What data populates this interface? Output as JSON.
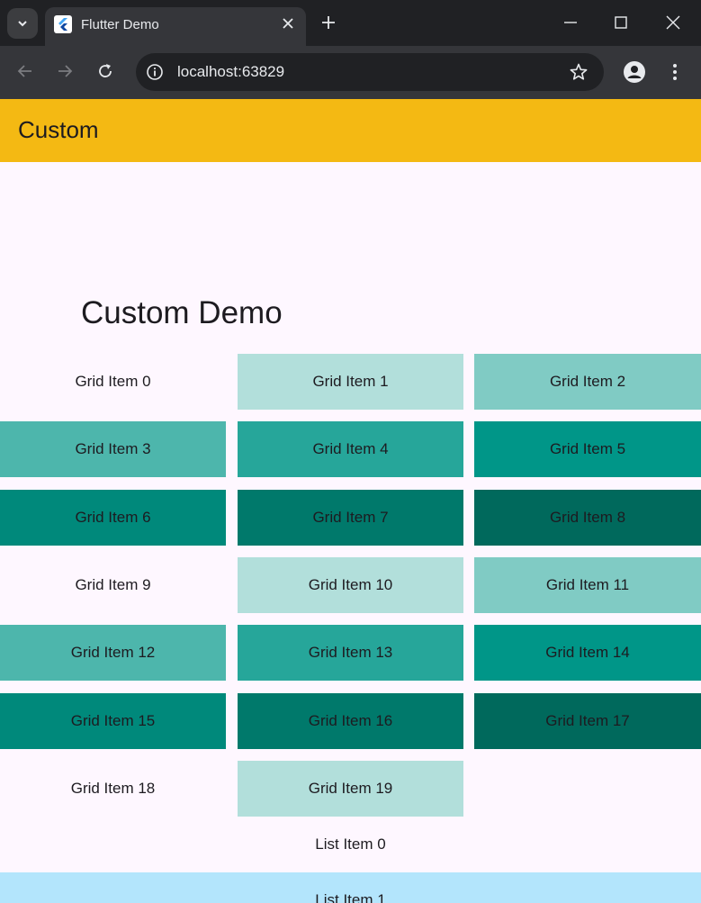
{
  "browser": {
    "tab_title": "Flutter Demo",
    "url": "localhost:63829"
  },
  "app": {
    "appbar_title": "Custom",
    "heading": "Custom Demo",
    "grid": [
      {
        "label": "Grid Item 0",
        "color": "#fef7ff"
      },
      {
        "label": "Grid Item 1",
        "color": "#b2dfdb"
      },
      {
        "label": "Grid Item 2",
        "color": "#80cbc4"
      },
      {
        "label": "Grid Item 3",
        "color": "#4db6ac"
      },
      {
        "label": "Grid Item 4",
        "color": "#26a69a"
      },
      {
        "label": "Grid Item 5",
        "color": "#009688"
      },
      {
        "label": "Grid Item 6",
        "color": "#00897b"
      },
      {
        "label": "Grid Item 7",
        "color": "#00796b"
      },
      {
        "label": "Grid Item 8",
        "color": "#00695c"
      },
      {
        "label": "Grid Item 9",
        "color": "#fef7ff"
      },
      {
        "label": "Grid Item 10",
        "color": "#b2dfdb"
      },
      {
        "label": "Grid Item 11",
        "color": "#80cbc4"
      },
      {
        "label": "Grid Item 12",
        "color": "#4db6ac"
      },
      {
        "label": "Grid Item 13",
        "color": "#26a69a"
      },
      {
        "label": "Grid Item 14",
        "color": "#009688"
      },
      {
        "label": "Grid Item 15",
        "color": "#00897b"
      },
      {
        "label": "Grid Item 16",
        "color": "#00796b"
      },
      {
        "label": "Grid Item 17",
        "color": "#00695c"
      },
      {
        "label": "Grid Item 18",
        "color": "#fef7ff"
      },
      {
        "label": "Grid Item 19",
        "color": "#b2dfdb"
      }
    ],
    "list": [
      {
        "label": "List Item 0",
        "color": "#fef7ff"
      },
      {
        "label": "List Item 1",
        "color": "#b3e5fc"
      }
    ]
  },
  "colors": {
    "appbar": "#f4b913",
    "background": "#fef7ff"
  }
}
